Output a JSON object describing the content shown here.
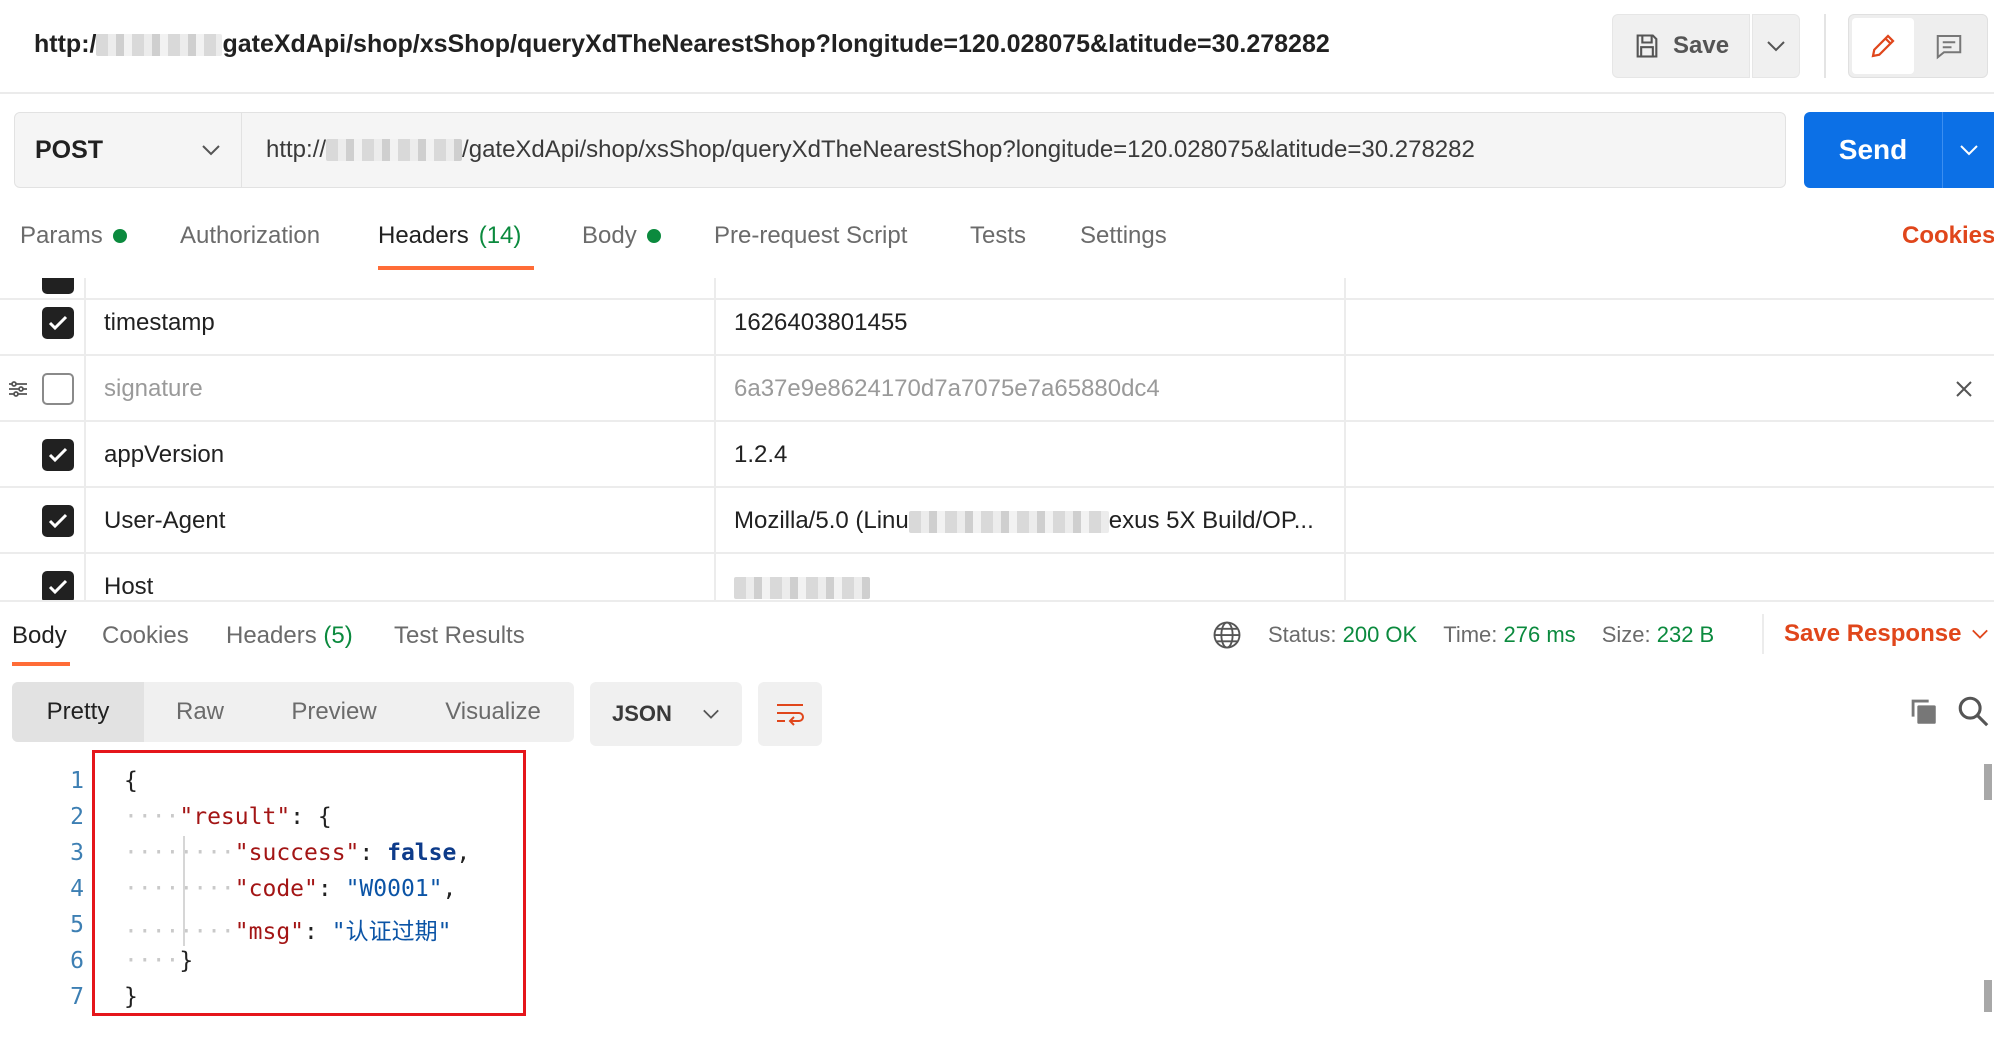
{
  "topbar": {
    "url_prefix": "http:/",
    "url_suffix": "gateXdApi/shop/xsShop/queryXdTheNearestShop?longitude=120.028075&latitude=30.278282",
    "save_label": "Save"
  },
  "request": {
    "method": "POST",
    "url_prefix": "http://",
    "url_suffix": "/gateXdApi/shop/xsShop/queryXdTheNearestShop?longitude=120.028075&latitude=30.278282",
    "send_label": "Send"
  },
  "request_tabs": {
    "params": "Params",
    "authorization": "Authorization",
    "headers": "Headers",
    "headers_count": "(14)",
    "body": "Body",
    "prerequest": "Pre-request Script",
    "tests": "Tests",
    "settings": "Settings",
    "cookies": "Cookies"
  },
  "headers_rows": [
    {
      "key": "timestamp",
      "value": "1626403801455",
      "enabled": true
    },
    {
      "key": "signature",
      "value": "6a37e9e8624170d7a7075e7a65880dc4",
      "enabled": false
    },
    {
      "key": "appVersion",
      "value": "1.2.4",
      "enabled": true
    },
    {
      "key": "User-Agent",
      "value_prefix": "Mozilla/5.0 (Linu",
      "value_suffix": "exus 5X Build/OP...",
      "enabled": true
    },
    {
      "key": "Host",
      "value": "",
      "enabled": true
    }
  ],
  "response_tabs": {
    "body": "Body",
    "cookies": "Cookies",
    "headers": "Headers",
    "headers_count": "(5)",
    "test_results": "Test Results"
  },
  "status": {
    "status_label": "Status:",
    "status_value": "200 OK",
    "time_label": "Time:",
    "time_value": "276 ms",
    "size_label": "Size:",
    "size_value": "232 B",
    "save_response": "Save Response"
  },
  "view": {
    "pretty": "Pretty",
    "raw": "Raw",
    "preview": "Preview",
    "visualize": "Visualize",
    "format": "JSON"
  },
  "code_lines": {
    "n1": "1",
    "n2": "2",
    "n3": "3",
    "n4": "4",
    "n5": "5",
    "n6": "6",
    "n7": "7",
    "open_brace": "{",
    "result_key": "\"result\"",
    "success_key": "\"success\"",
    "success_val": "false",
    "code_key": "\"code\"",
    "code_val": "\"W0001\"",
    "msg_key": "\"msg\"",
    "msg_val": "\"认证过期\"",
    "close_inner": "}",
    "close_outer": "}"
  },
  "colors": {
    "accent": "#ff6c37",
    "send": "#0c70e6",
    "ok_green": "#0b8a3e",
    "highlight_red": "#e5161b"
  }
}
